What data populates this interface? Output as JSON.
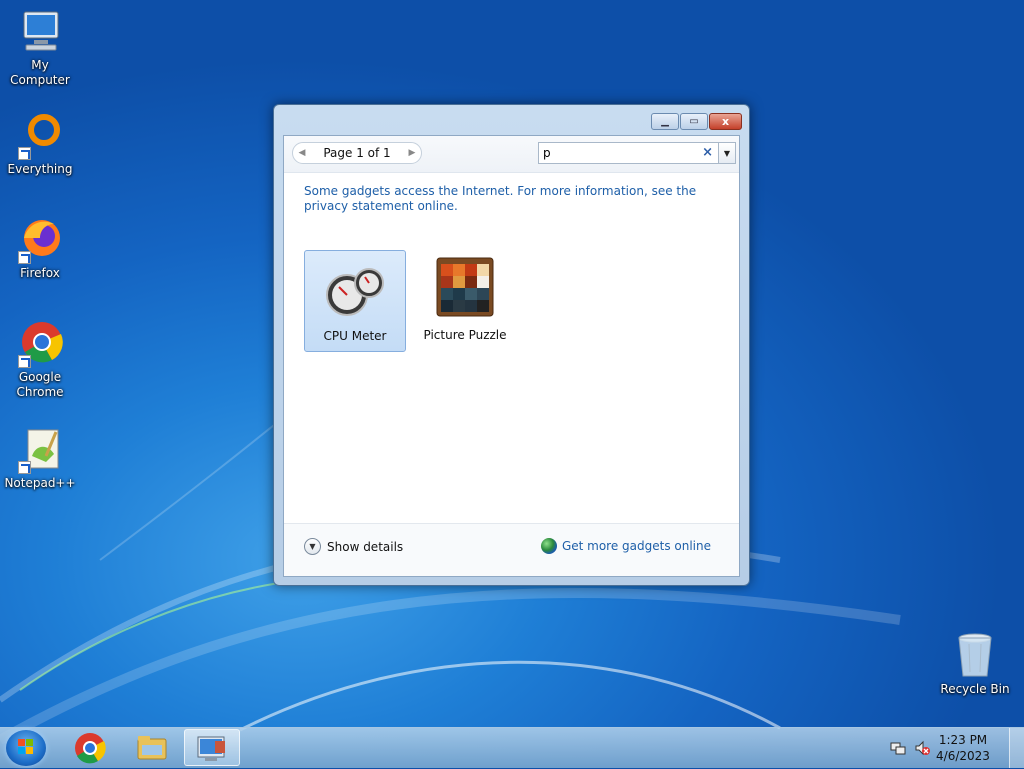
{
  "desktop": {
    "icons": [
      {
        "label": "My Computer"
      },
      {
        "label": "Everything"
      },
      {
        "label": "Firefox"
      },
      {
        "label": "Google Chrome"
      },
      {
        "label": "Notepad++"
      },
      {
        "label": "Recycle Bin"
      }
    ]
  },
  "window": {
    "pager_label": "Page 1 of 1",
    "search_value": "p",
    "clear_glyph": "×",
    "info_text": "Some gadgets access the Internet.  For more information, see the privacy statement online.",
    "gadgets": [
      {
        "name": "CPU Meter",
        "selected": true
      },
      {
        "name": "Picture Puzzle",
        "selected": false
      }
    ],
    "show_details": "Show details",
    "more_online": "Get more gadgets online",
    "close_glyph": "x",
    "colors": {
      "link": "#1e5fa8",
      "selection": "#c4dcf6",
      "close": "#c4402a"
    }
  },
  "taskbar": {
    "time": "1:23 PM",
    "date": "4/6/2023"
  }
}
